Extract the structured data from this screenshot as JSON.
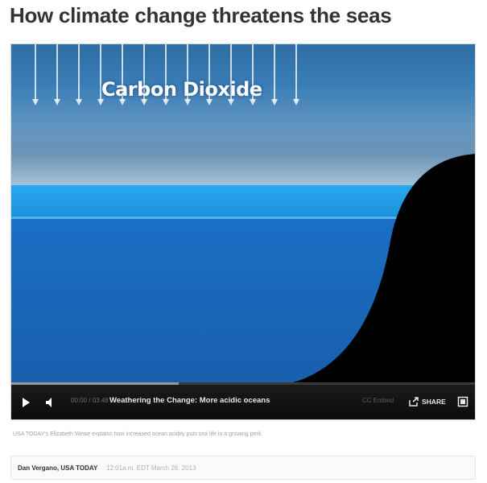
{
  "article": {
    "headline": "How climate change threatens the seas"
  },
  "video": {
    "overlay_text": "Carbon Dioxide",
    "colors": {
      "sky": "#3a7db6",
      "surface_band": "#28a8ee",
      "sea": "#1a66b8",
      "land": "#000000",
      "control_bar": "#111111"
    },
    "controls": {
      "play_icon": "play-icon",
      "volume_icon": "volume-icon",
      "time": "00:00 / 03:48",
      "title": "Weathering the Change: More acidic oceans",
      "cc_label": "CC   Embed",
      "share_label": "SHARE",
      "share_icon": "share-icon",
      "fullscreen_icon": "fullscreen-icon",
      "progress_fraction": 0.36
    }
  },
  "caption": "USA TODAY's Elizabeth Weise explains how increased ocean acidity puts sea life in a growing peril.",
  "byline": {
    "author": "Dan Vergano, USA TODAY",
    "date": "12:01a.m. EDT March 26, 2013"
  }
}
